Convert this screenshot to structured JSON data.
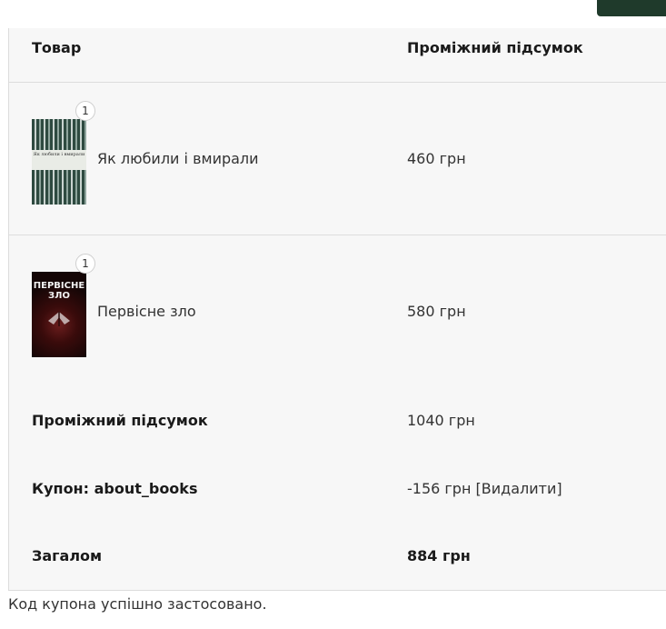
{
  "table": {
    "header_product": "Товар",
    "header_subtotal": "Проміжний підсумок"
  },
  "items": [
    {
      "quantity": "1",
      "name": "Як любили і вмирали",
      "price": "460 грн",
      "cover_text": "Як любили і вмирали"
    },
    {
      "quantity": "1",
      "name": "Первісне зло",
      "price": "580 грн",
      "cover_title": "ПЕРВІСНЕ ЗЛО"
    }
  ],
  "totals": {
    "subtotal_label": "Проміжний підсумок",
    "subtotal_value": "1040 грн",
    "coupon_label": "Купон: about_books",
    "coupon_value": "-156 грн",
    "coupon_remove": "[Видалити]",
    "total_label": "Загалом",
    "total_value": "884 грн"
  },
  "notice": "Код купона успішно застосовано.",
  "colors": {
    "accent_button": "#1f3a2b",
    "table_bg": "#f7f7f7"
  }
}
